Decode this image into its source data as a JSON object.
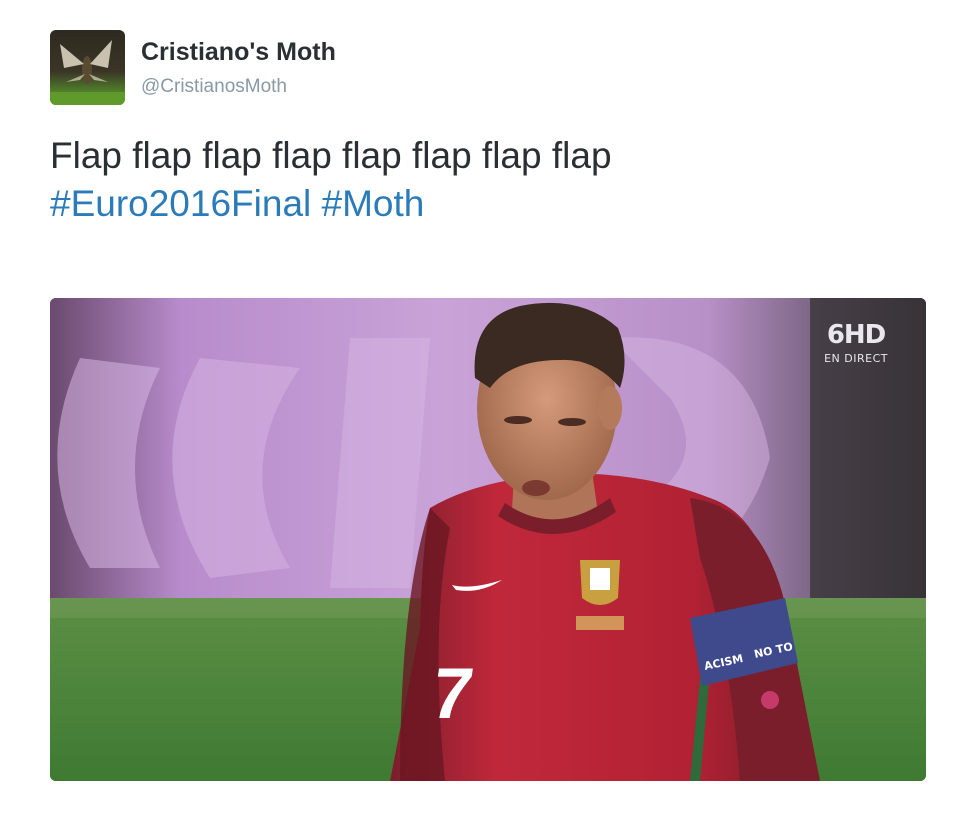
{
  "author": {
    "display_name": "Cristiano's Moth",
    "handle": "@CristianosMoth"
  },
  "tweet": {
    "text": "Flap flap flap flap flap flap flap flap",
    "hashtags": [
      "#Euro2016Final",
      "#Moth"
    ]
  },
  "media": {
    "broadcaster_logo": "6HD",
    "broadcaster_sub": "EN DIRECT",
    "jersey_number": "7",
    "armband_text_left": "ACISM",
    "armband_text_right": "NO TO"
  },
  "colors": {
    "name": "#292f33",
    "handle": "#8899a6",
    "hashtag": "#2b7bb9",
    "jersey_red": "#c0283a",
    "jersey_maroon": "#7a1e2c",
    "pitch_green": "#4f8a3c",
    "board_purple": "#b07cc6"
  }
}
